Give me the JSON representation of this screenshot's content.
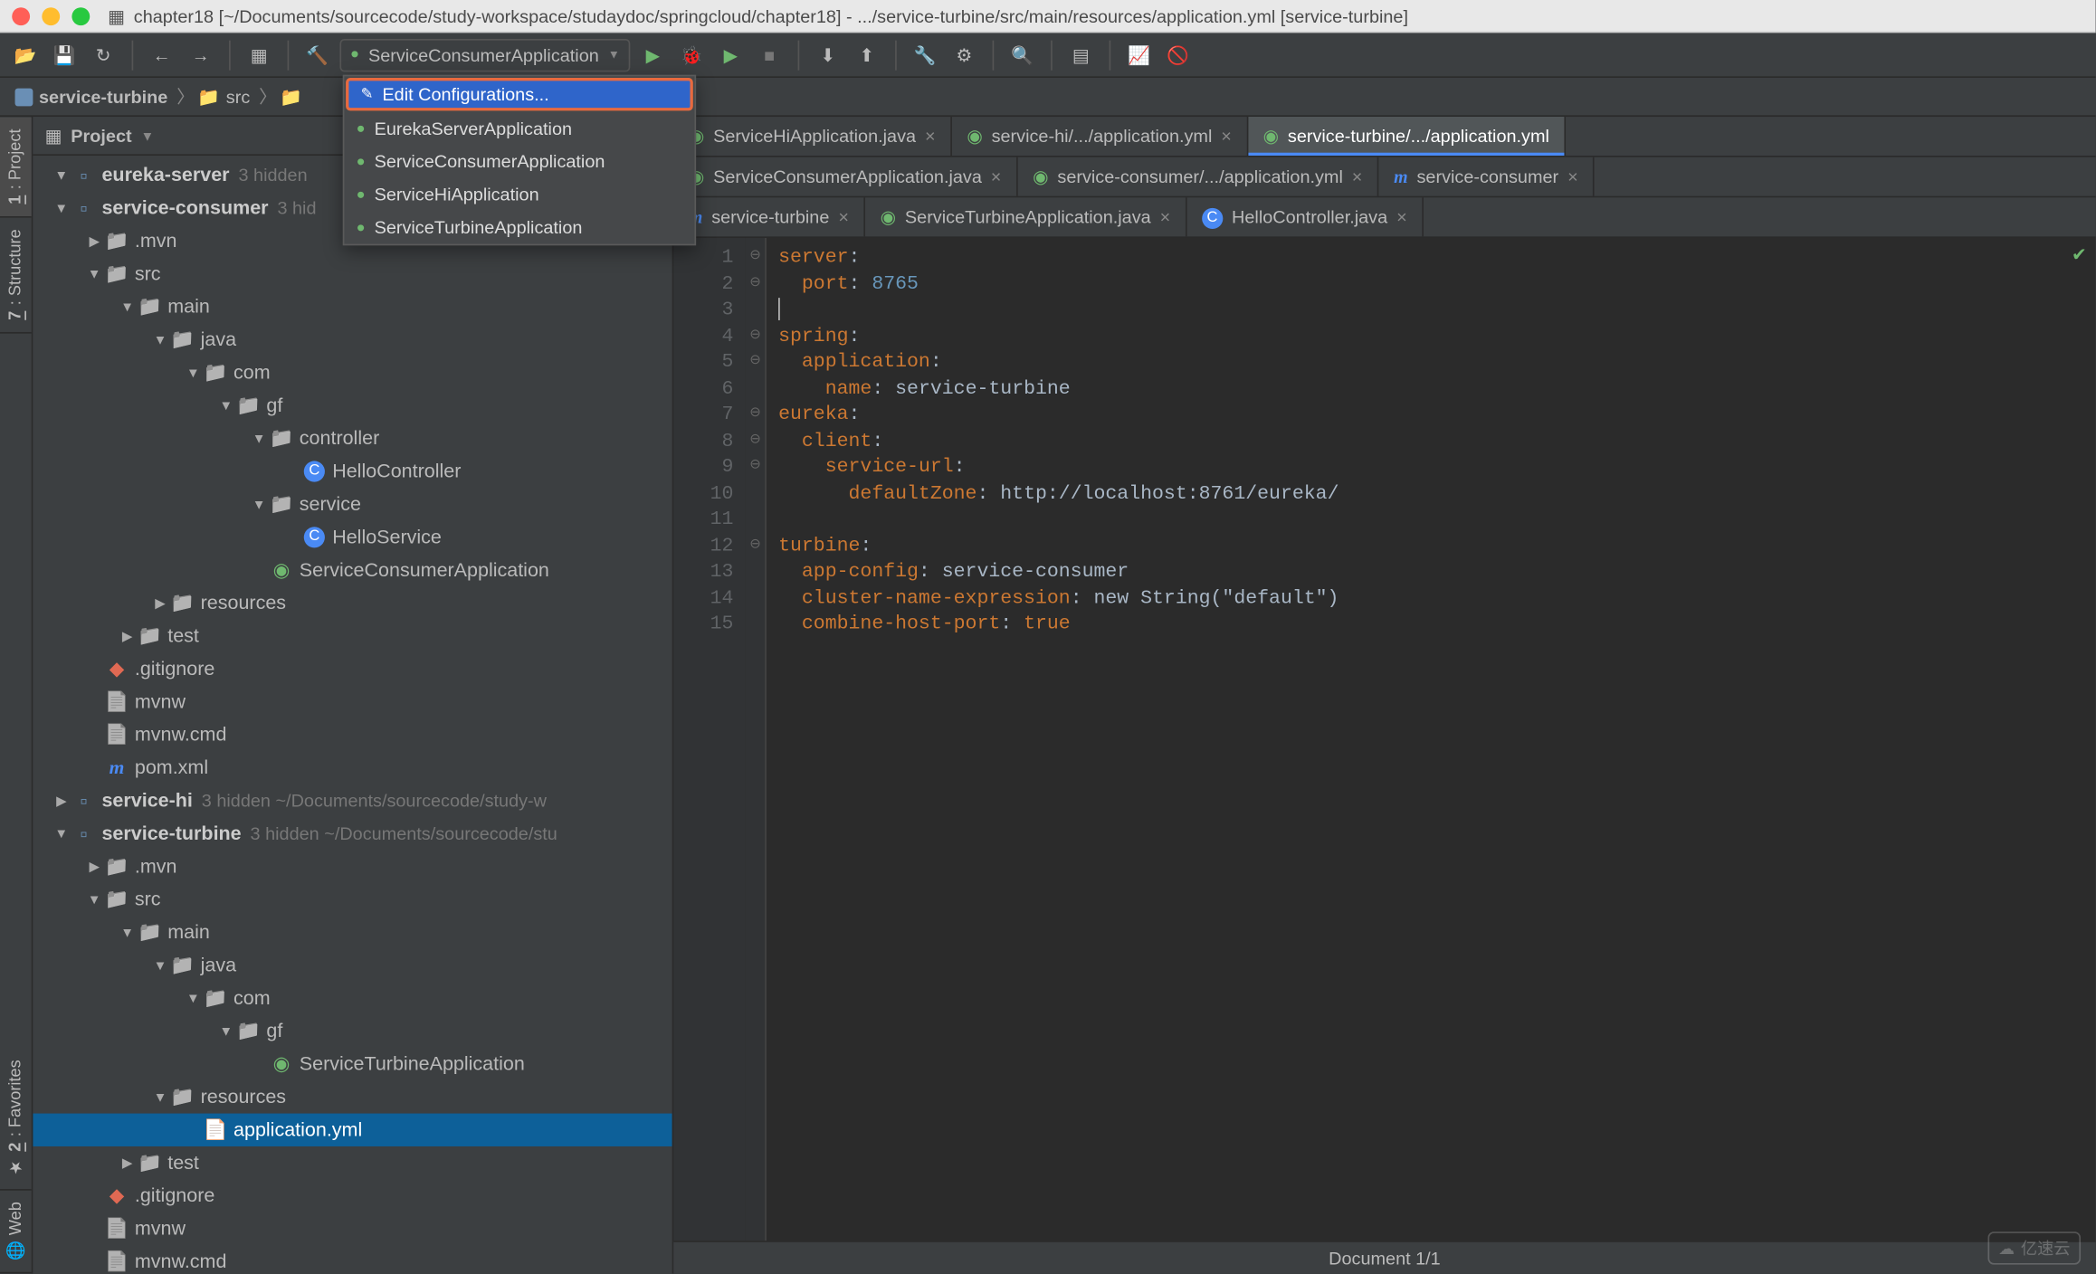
{
  "window": {
    "title": "chapter18 [~/Documents/sourcecode/study-workspace/studaydoc/springcloud/chapter18] - .../service-turbine/src/main/resources/application.yml [service-turbine]"
  },
  "runconfig": {
    "selected": "ServiceConsumerApplication",
    "dropdown": {
      "edit": "Edit Configurations...",
      "items": [
        "EurekaServerApplication",
        "ServiceConsumerApplication",
        "ServiceHiApplication",
        "ServiceTurbineApplication"
      ]
    }
  },
  "breadcrumb": {
    "items": [
      "service-turbine",
      "src",
      "",
      "yml"
    ]
  },
  "left_tabs": {
    "project": "1: Project",
    "structure": "7: Structure",
    "favorites": "2: Favorites",
    "web": "Web"
  },
  "project_panel": {
    "title": "Project"
  },
  "tree": {
    "r": [
      {
        "d": 0,
        "a": "open",
        "i": "module",
        "t": "eureka-server",
        "b": 1,
        "h": "3 hidden"
      },
      {
        "d": 0,
        "a": "open",
        "i": "module",
        "t": "service-consumer",
        "b": 1,
        "h": "3 hid"
      },
      {
        "d": 1,
        "a": "closed",
        "i": "folder",
        "t": ".mvn"
      },
      {
        "d": 1,
        "a": "open",
        "i": "folder",
        "t": "src"
      },
      {
        "d": 2,
        "a": "open",
        "i": "folder",
        "t": "main"
      },
      {
        "d": 3,
        "a": "open",
        "i": "folder",
        "t": "java"
      },
      {
        "d": 4,
        "a": "open",
        "i": "folder",
        "t": "com"
      },
      {
        "d": 5,
        "a": "open",
        "i": "folder",
        "t": "gf"
      },
      {
        "d": 6,
        "a": "open",
        "i": "folder",
        "t": "controller"
      },
      {
        "d": 7,
        "a": "none",
        "i": "java",
        "t": "HelloController"
      },
      {
        "d": 6,
        "a": "open",
        "i": "folder",
        "t": "service"
      },
      {
        "d": 7,
        "a": "none",
        "i": "java",
        "t": "HelloService"
      },
      {
        "d": 6,
        "a": "none",
        "i": "spring",
        "t": "ServiceConsumerApplication"
      },
      {
        "d": 3,
        "a": "closed",
        "i": "folder",
        "t": "resources"
      },
      {
        "d": 2,
        "a": "closed",
        "i": "folder",
        "t": "test"
      },
      {
        "d": 1,
        "a": "none",
        "i": "git",
        "t": ".gitignore"
      },
      {
        "d": 1,
        "a": "none",
        "i": "file",
        "t": "mvnw"
      },
      {
        "d": 1,
        "a": "none",
        "i": "file",
        "t": "mvnw.cmd"
      },
      {
        "d": 1,
        "a": "none",
        "i": "xml",
        "t": "pom.xml"
      },
      {
        "d": 0,
        "a": "closed",
        "i": "module",
        "t": "service-hi",
        "b": 1,
        "h": "3 hidden  ~/Documents/sourcecode/study-w"
      },
      {
        "d": 0,
        "a": "open",
        "i": "module",
        "t": "service-turbine",
        "b": 1,
        "h": "3 hidden  ~/Documents/sourcecode/stu"
      },
      {
        "d": 1,
        "a": "closed",
        "i": "folder",
        "t": ".mvn"
      },
      {
        "d": 1,
        "a": "open",
        "i": "folder",
        "t": "src"
      },
      {
        "d": 2,
        "a": "open",
        "i": "folder",
        "t": "main"
      },
      {
        "d": 3,
        "a": "open",
        "i": "folder",
        "t": "java"
      },
      {
        "d": 4,
        "a": "open",
        "i": "folder",
        "t": "com"
      },
      {
        "d": 5,
        "a": "open",
        "i": "folder",
        "t": "gf"
      },
      {
        "d": 6,
        "a": "none",
        "i": "spring",
        "t": "ServiceTurbineApplication"
      },
      {
        "d": 3,
        "a": "open",
        "i": "folder",
        "t": "resources"
      },
      {
        "d": 4,
        "a": "none",
        "i": "yml",
        "t": "application.yml",
        "sel": 1
      },
      {
        "d": 2,
        "a": "closed",
        "i": "folder",
        "t": "test"
      },
      {
        "d": 1,
        "a": "none",
        "i": "git",
        "t": ".gitignore"
      },
      {
        "d": 1,
        "a": "none",
        "i": "file",
        "t": "mvnw"
      },
      {
        "d": 1,
        "a": "none",
        "i": "file",
        "t": "mvnw.cmd"
      }
    ]
  },
  "tabs": {
    "row1": [
      {
        "i": "spring",
        "t": "ServiceHiApplication.java"
      },
      {
        "i": "spring",
        "t": "service-hi/.../application.yml"
      },
      {
        "i": "spring",
        "t": "service-turbine/.../application.yml",
        "active": 1
      }
    ],
    "row2": [
      {
        "i": "spring",
        "t": "ServiceConsumerApplication.java"
      },
      {
        "i": "spring",
        "t": "service-consumer/.../application.yml"
      },
      {
        "i": "xml",
        "t": "service-consumer"
      }
    ],
    "row3": [
      {
        "i": "xml",
        "t": "service-turbine"
      },
      {
        "i": "spring",
        "t": "ServiceTurbineApplication.java"
      },
      {
        "i": "java",
        "t": "HelloController.java"
      }
    ]
  },
  "code": {
    "lines": [
      [
        {
          "c": "k-orange",
          "t": "server"
        },
        {
          "c": "k-grey",
          "t": ":"
        }
      ],
      [
        {
          "c": "k-grey",
          "t": "  "
        },
        {
          "c": "k-orange",
          "t": "port"
        },
        {
          "c": "k-grey",
          "t": ": "
        },
        {
          "c": "k-blue",
          "t": "8765"
        }
      ],
      [
        {
          "c": "k-grey",
          "t": ""
        }
      ],
      [
        {
          "c": "k-orange",
          "t": "spring"
        },
        {
          "c": "k-grey",
          "t": ":"
        }
      ],
      [
        {
          "c": "k-grey",
          "t": "  "
        },
        {
          "c": "k-orange",
          "t": "application"
        },
        {
          "c": "k-grey",
          "t": ":"
        }
      ],
      [
        {
          "c": "k-grey",
          "t": "    "
        },
        {
          "c": "k-orange",
          "t": "name"
        },
        {
          "c": "k-grey",
          "t": ": service-turbine"
        }
      ],
      [
        {
          "c": "k-orange",
          "t": "eureka"
        },
        {
          "c": "k-grey",
          "t": ":"
        }
      ],
      [
        {
          "c": "k-grey",
          "t": "  "
        },
        {
          "c": "k-orange",
          "t": "client"
        },
        {
          "c": "k-grey",
          "t": ":"
        }
      ],
      [
        {
          "c": "k-grey",
          "t": "    "
        },
        {
          "c": "k-orange",
          "t": "service-url"
        },
        {
          "c": "k-grey",
          "t": ":"
        }
      ],
      [
        {
          "c": "k-grey",
          "t": "      "
        },
        {
          "c": "k-orange",
          "t": "defaultZone"
        },
        {
          "c": "k-grey",
          "t": ": http://localhost:8761/eureka/"
        }
      ],
      [
        {
          "c": "k-grey",
          "t": ""
        }
      ],
      [
        {
          "c": "k-orange",
          "t": "turbine"
        },
        {
          "c": "k-grey",
          "t": ":"
        }
      ],
      [
        {
          "c": "k-grey",
          "t": "  "
        },
        {
          "c": "k-orange",
          "t": "app-config"
        },
        {
          "c": "k-grey",
          "t": ": service-consumer"
        }
      ],
      [
        {
          "c": "k-grey",
          "t": "  "
        },
        {
          "c": "k-orange",
          "t": "cluster-name-expression"
        },
        {
          "c": "k-grey",
          "t": ": new String(\"default\")"
        }
      ],
      [
        {
          "c": "k-grey",
          "t": "  "
        },
        {
          "c": "k-orange",
          "t": "combine-host-port"
        },
        {
          "c": "k-grey",
          "t": ": "
        },
        {
          "c": "k-orange",
          "t": "true"
        }
      ]
    ]
  },
  "status": {
    "doc": "Document 1/1"
  },
  "watermark": "亿速云"
}
